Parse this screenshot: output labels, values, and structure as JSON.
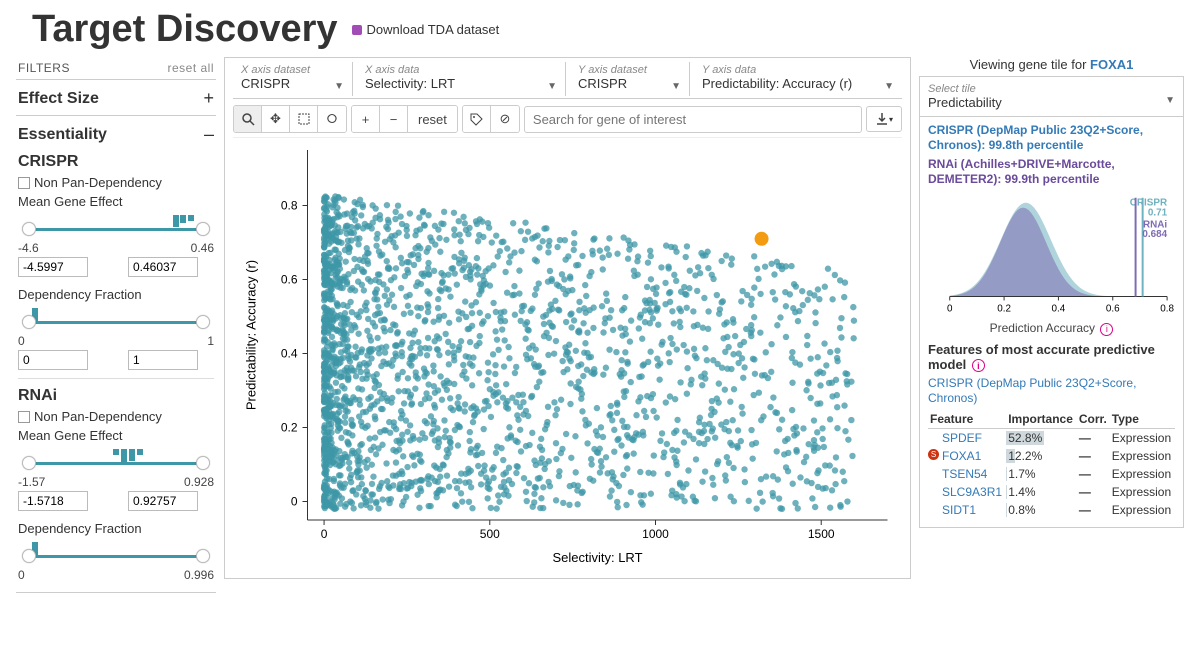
{
  "page": {
    "title": "Target Discovery",
    "download": "Download TDA dataset"
  },
  "filters": {
    "header_label": "FILTERS",
    "reset": "reset all",
    "effect_size": {
      "title": "Effect Size",
      "collapsed": true
    },
    "essentiality": {
      "title": "Essentiality",
      "crispr": {
        "label": "CRISPR",
        "cb": "Non Pan-Dependency",
        "mge": {
          "label": "Mean Gene Effect",
          "min_lbl": "-4.6",
          "max_lbl": "0.46",
          "min_val": "-4.5997",
          "max_val": "0.46037"
        },
        "dep": {
          "label": "Dependency Fraction",
          "min_lbl": "0",
          "max_lbl": "1",
          "min_val": "0",
          "max_val": "1"
        }
      },
      "rnai": {
        "label": "RNAi",
        "cb": "Non Pan-Dependency",
        "mge": {
          "label": "Mean Gene Effect",
          "min_lbl": "-1.57",
          "max_lbl": "0.928",
          "min_val": "-1.5718",
          "max_val": "0.92757"
        },
        "dep": {
          "label": "Dependency Fraction",
          "min_lbl": "0",
          "max_lbl": "0.996"
        }
      }
    }
  },
  "axis_selectors": {
    "x_dataset": {
      "label": "X axis dataset",
      "value": "CRISPR"
    },
    "x_data": {
      "label": "X axis data",
      "value": "Selectivity: LRT"
    },
    "y_dataset": {
      "label": "Y axis dataset",
      "value": "CRISPR"
    },
    "y_data": {
      "label": "Y axis data",
      "value": "Predictability: Accuracy (r)"
    }
  },
  "toolbar": {
    "reset": "reset",
    "search_placeholder": "Search for gene of interest"
  },
  "chart_data": {
    "type": "scatter",
    "title": "",
    "xlabel": "Selectivity:  LRT",
    "ylabel": "Predictability:  Accuracy (r)",
    "xlim": [
      -50,
      1700
    ],
    "ylim": [
      -0.05,
      0.95
    ],
    "xticks": [
      0,
      500,
      1000,
      1500
    ],
    "yticks": [
      0,
      0.2,
      0.4,
      0.6,
      0.8
    ],
    "highlight": {
      "name": "FOXA1",
      "x": 1320,
      "y": 0.71,
      "color": "#f39c12"
    },
    "approx_cloud_density_note": "dense cluster x∈[0,300], y∈[0,0.85]; sparse tail to x≈1600"
  },
  "right": {
    "viewing_prefix": "Viewing gene tile for ",
    "viewing_gene": "FOXA1",
    "select_tile_label": "Select tile",
    "select_tile_value": "Predictability",
    "stat1_label": "CRISPR (DepMap Public 23Q2+Score, Chronos): 99.8th percentile",
    "stat2_label": "RNAi (Achilles+DRIVE+Marcotte, DEMETER2): 99.9th percentile",
    "density_chart": {
      "type": "area",
      "xlabel": "Prediction Accuracy",
      "xlim": [
        0,
        0.8
      ],
      "xticks": [
        0,
        0.2,
        0.4,
        0.6,
        0.8
      ],
      "series": [
        {
          "name": "CRISPR",
          "color": "#6fb1c0",
          "marker_x": 0.71,
          "marker_label": "CRISPR",
          "marker_value": "0.71"
        },
        {
          "name": "RNAi",
          "color": "#7e6bb3",
          "marker_x": 0.684,
          "marker_label": "RNAi",
          "marker_value": "0.684"
        }
      ],
      "shape_note": "overlapping density peaks near x≈0.28"
    },
    "features_title": "Features of most accurate predictive model",
    "features_subtitle": "CRISPR (DepMap Public 23Q2+Score, Chronos)",
    "table": {
      "headers": [
        "Feature",
        "Importance",
        "Corr.",
        "Type"
      ],
      "rows": [
        {
          "gene": "SPDEF",
          "imp": "52.8%",
          "imp_pct": 52.8,
          "corr": "—",
          "type": "Expression",
          "self": false
        },
        {
          "gene": "FOXA1",
          "imp": "12.2%",
          "imp_pct": 12.2,
          "corr": "—",
          "type": "Expression",
          "self": true
        },
        {
          "gene": "TSEN54",
          "imp": "1.7%",
          "imp_pct": 1.7,
          "corr": "—",
          "type": "Expression",
          "self": false
        },
        {
          "gene": "SLC9A3R1",
          "imp": "1.4%",
          "imp_pct": 1.4,
          "corr": "—",
          "type": "Expression",
          "self": false
        },
        {
          "gene": "SIDT1",
          "imp": "0.8%",
          "imp_pct": 0.8,
          "corr": "—",
          "type": "Expression",
          "self": false
        }
      ]
    }
  }
}
